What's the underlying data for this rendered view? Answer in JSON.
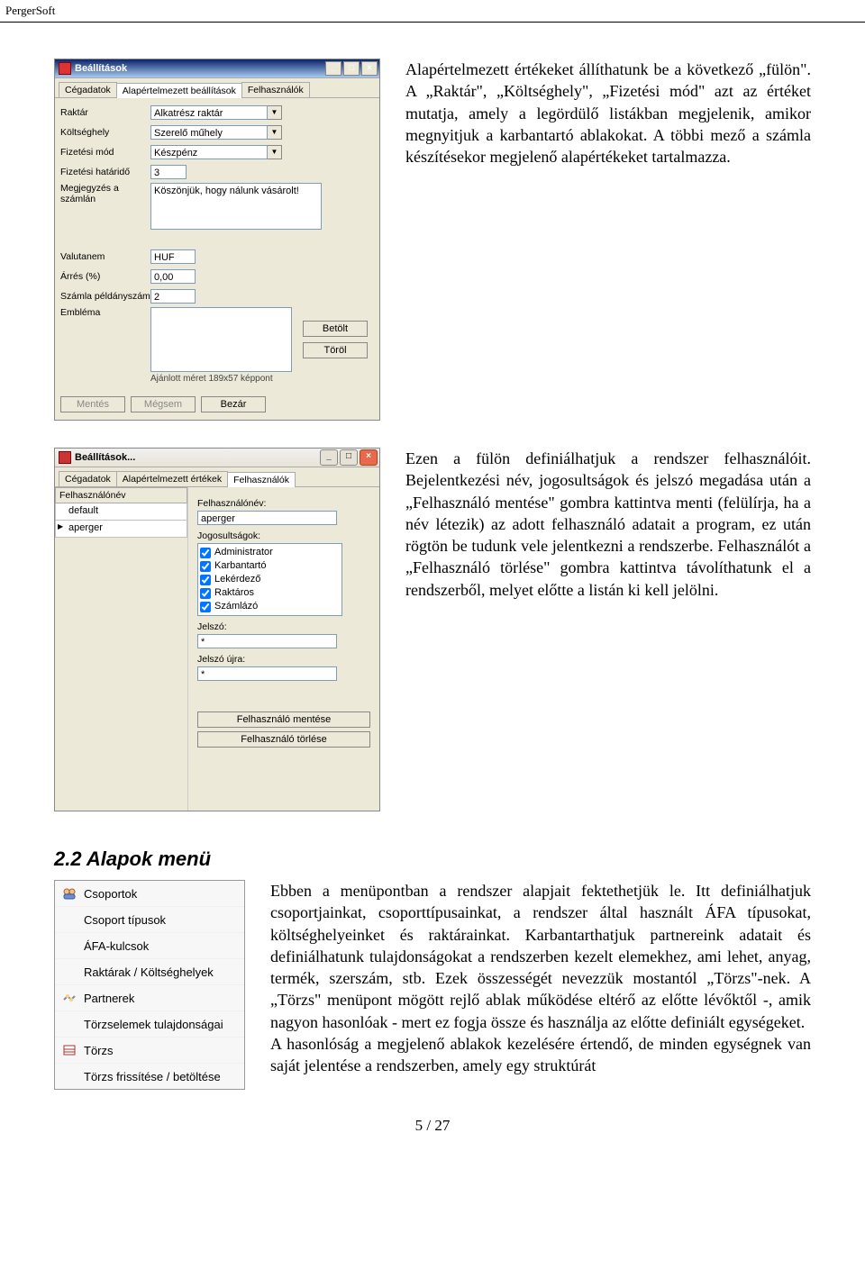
{
  "header": "PergerSoft",
  "win1": {
    "title": "Beállítások",
    "tabs": [
      "Cégadatok",
      "Alapértelmezett beállítások",
      "Felhasználók"
    ],
    "activeTab": 1,
    "rows": {
      "raktar_lbl": "Raktár",
      "raktar_val": "Alkatrész raktár",
      "koltseghely_lbl": "Költséghely",
      "koltseghely_val": "Szerelő műhely",
      "fizmod_lbl": "Fizetési mód",
      "fizmod_val": "Készpénz",
      "fizhat_lbl": "Fizetési határidő",
      "fizhat_val": "3",
      "megj_lbl": "Megjegyzés a számlán",
      "megj_val": "Köszönjük, hogy nálunk vásárolt!",
      "valuta_lbl": "Valutanem",
      "valuta_val": "HUF",
      "arres_lbl": "Árrés (%)",
      "arres_val": "0,00",
      "peldany_lbl": "Számla példányszám",
      "peldany_val": "2",
      "emblema_lbl": "Embléma",
      "betolt": "Betölt",
      "torol": "Töröl",
      "hint": "Ajánlott méret 189x57 képpont"
    },
    "buttons": {
      "mentes": "Mentés",
      "megsem": "Mégsem",
      "bezar": "Bezár"
    }
  },
  "para1": "Alapértelmezett értékeket állíthatunk be a következő „fülön\". A „Raktár\", „Költséghely\", „Fizetési mód\" azt az értéket mutatja, amely a legördülő listákban megjelenik, amikor megnyitjuk a karbantartó ablakokat. A többi mező a számla készítésekor megjelenő alapértékeket tartalmazza.",
  "win2": {
    "title": "Beállítások...",
    "tabs": [
      "Cégadatok",
      "Alapértelmezett értékek",
      "Felhasználók"
    ],
    "activeTab": 2,
    "gridHeader": "Felhasználónév",
    "users": [
      "default",
      "aperger"
    ],
    "labels": {
      "felhnev": "Felhasználónév:",
      "felhnev_val": "aperger",
      "jogok": "Jogosultságok:",
      "jelszo": "Jelszó:",
      "jelszo_ujra": "Jelszó újra:"
    },
    "rights": [
      "Administrator",
      "Karbantartó",
      "Lekérdező",
      "Raktáros",
      "Számlázó"
    ],
    "pw_mask": "*",
    "btn_save": "Felhasználó mentése",
    "btn_del": "Felhasználó törlése"
  },
  "para2": "Ezen a fülön definiálhatjuk a rendszer felhasználóit. Bejelentkezési név, jogosultságok és jelszó megadása után a „Felhasználó mentése\" gombra kattintva menti (felülírja, ha a név létezik) az adott felhasználó adatait a program, ez után rögtön be tudunk vele jelentkezni a rendszerbe. Felhasználót a „Felhasználó törlése\" gombra kattintva távolíthatunk el a rendszerből, melyet előtte a listán ki kell jelölni.",
  "section": "2.2  Alapok menü",
  "menu": {
    "items": [
      {
        "label": "Csoportok",
        "icon": "groups"
      },
      {
        "label": "Csoport típusok",
        "icon": ""
      },
      {
        "label": "ÁFA-kulcsok",
        "icon": ""
      },
      {
        "label": "Raktárak / Költséghelyek",
        "icon": ""
      },
      {
        "label": "Partnerek",
        "icon": "partners"
      },
      {
        "label": "Törzselemek tulajdonságai",
        "icon": ""
      },
      {
        "label": "Törzs",
        "icon": "torzs"
      },
      {
        "label": "Törzs frissítése / betöltése",
        "icon": ""
      }
    ]
  },
  "para3": "Ebben a menüpontban a rendszer alapjait fektethetjük le. Itt definiálhatjuk csoportjainkat, csoporttípusainkat, a rendszer által használt ÁFA típusokat, költséghelyeinket és raktárainkat. Karbantarthatjuk partnereink adatait és definiálhatunk tulajdonságokat a rendszerben kezelt elemekhez, ami lehet, anyag, termék, szerszám, stb. Ezek összességét nevezzük mostantól „Törzs\"-nek. A „Törzs\" menüpont mögött rejlő ablak működése eltérő az előtte lévőktől -, amik nagyon hasonlóak - mert ez fogja össze és használja az előtte definiált egységeket.",
  "para4": "A hasonlóság a megjelenő ablakok kezelésére értendő, de minden egységnek van saját jelentése a rendszerben, amely egy struktúrát",
  "pagenum": "5 / 27"
}
